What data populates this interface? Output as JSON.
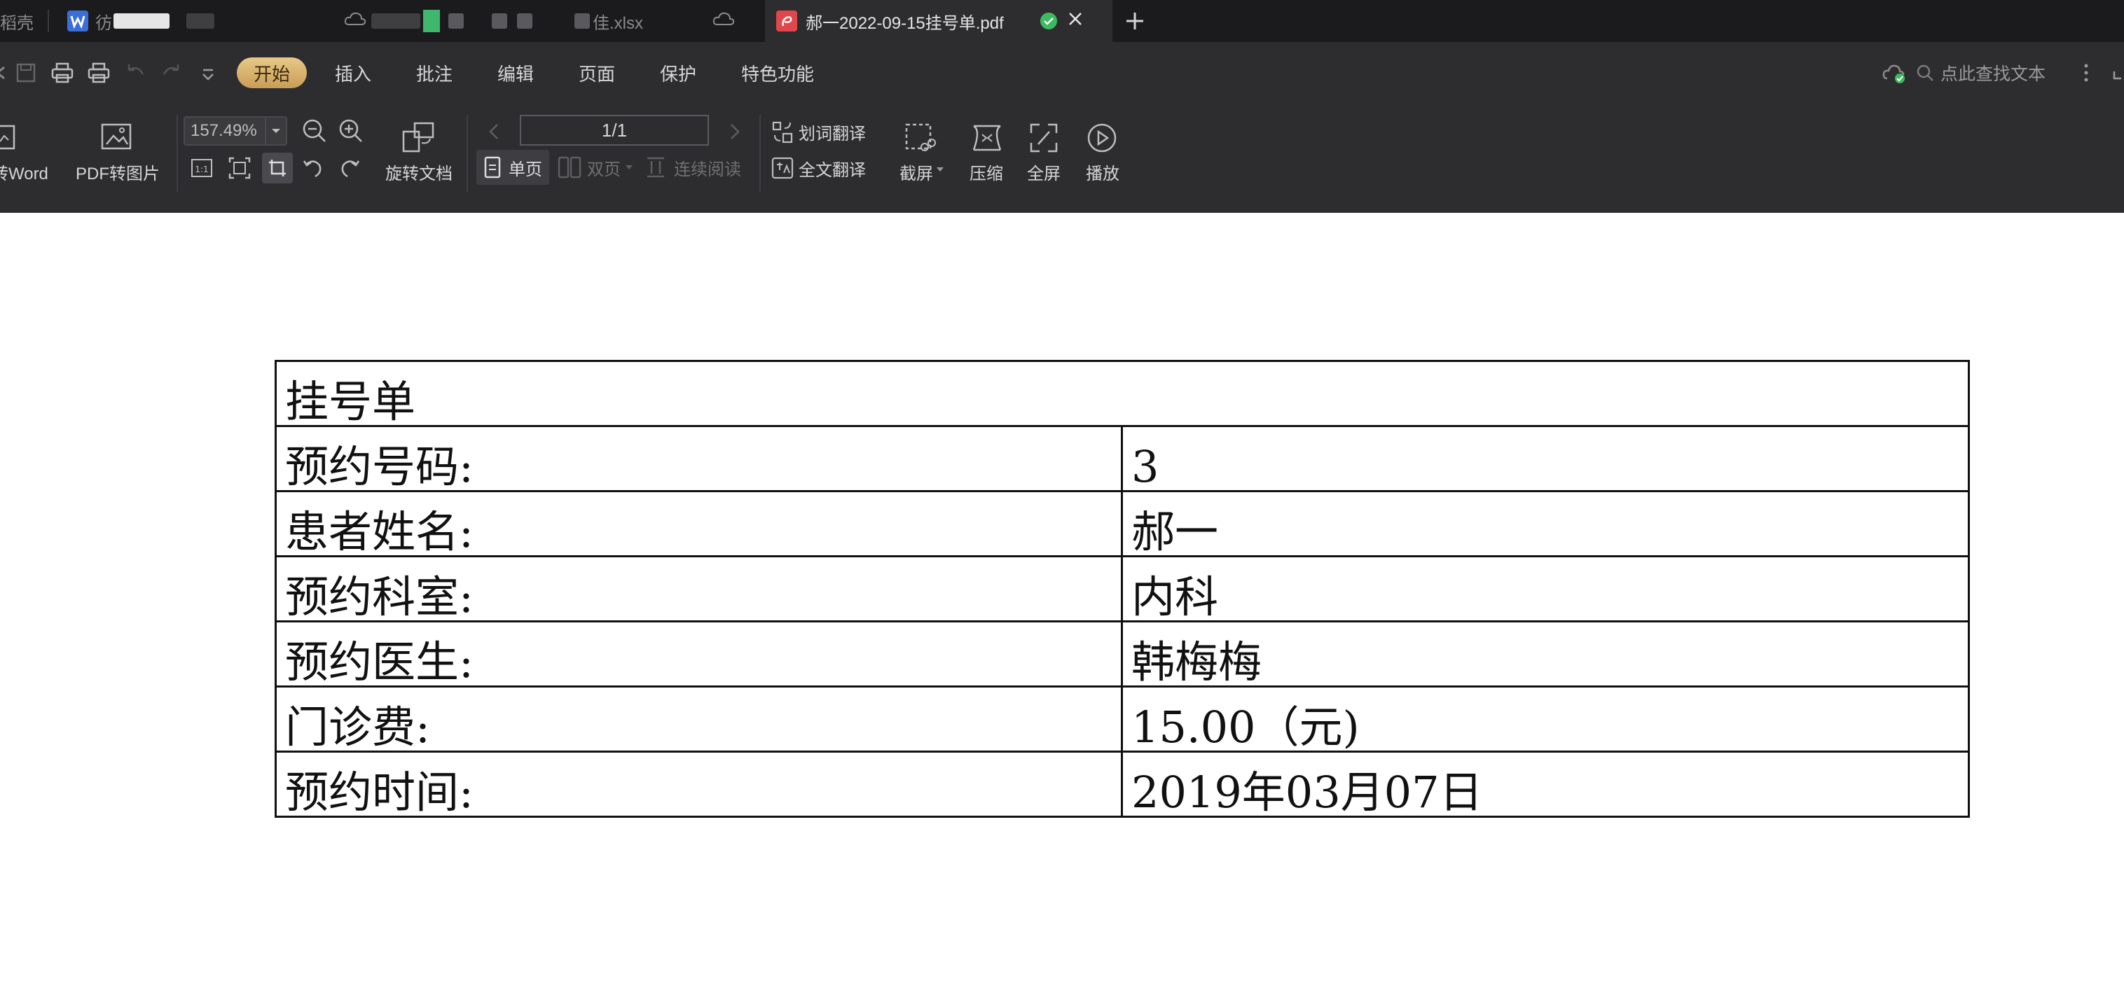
{
  "tabs": [
    {
      "label": "稻壳"
    },
    {
      "label": "彷",
      "blurred": true
    },
    {
      "label": "",
      "blurred": true
    },
    {
      "label": "佳.xlsx",
      "blurred": true
    },
    {
      "label": "郝一2022-09-15挂号单.pdf",
      "active": true
    }
  ],
  "menu": {
    "items": [
      "开始",
      "插入",
      "批注",
      "编辑",
      "页面",
      "保护",
      "特色功能"
    ],
    "search_label": "点此查找文本"
  },
  "ribbon": {
    "to_word": "转Word",
    "pdf_to_image": "PDF转图片",
    "zoom": "157.49%",
    "rotate_doc": "旋转文档",
    "page_indicator": "1/1",
    "single_page": "单页",
    "double_page": "双页",
    "continuous": "连续阅读",
    "word_translate": "划词翻译",
    "full_translate": "全文翻译",
    "screenshot": "截屏",
    "compress": "压缩",
    "fullscreen": "全屏",
    "play": "播放"
  },
  "document": {
    "title": "挂号单",
    "rows": [
      {
        "label": "预约号码:",
        "value": "3"
      },
      {
        "label": "患者姓名:",
        "value": "郝一"
      },
      {
        "label": "预约科室:",
        "value": "内科"
      },
      {
        "label": "预约医生:",
        "value": "韩梅梅"
      },
      {
        "label": "门诊费:",
        "value": "15.00（元)"
      },
      {
        "label": "预约时间:",
        "value": "2019年03月07日"
      }
    ]
  },
  "colors": {
    "titlebar_bg": "#1b1b1d",
    "toolbar_bg": "#2d2d30",
    "accent_gold": "#d9b26c",
    "pdf_tab_icon": "#e0474c",
    "word_icon": "#3b6fd8",
    "sync_ok": "#3dbb61"
  }
}
